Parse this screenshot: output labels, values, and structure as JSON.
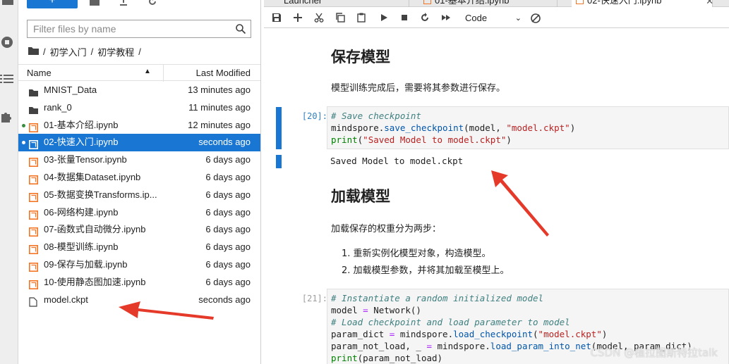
{
  "activity_bar": {
    "icons": [
      "folder-icon",
      "running-icon",
      "list-icon",
      "extension-icon"
    ]
  },
  "file_browser": {
    "new_button_label": "+",
    "filter_placeholder": "Filter files by name",
    "breadcrumbs": [
      "/",
      "初学入门",
      "/",
      "初学教程",
      "/"
    ],
    "header": {
      "name": "Name",
      "last_modified": "Last Modified"
    },
    "files": [
      {
        "name": "MNIST_Data",
        "modified": "13 minutes ago",
        "type": "folder"
      },
      {
        "name": "rank_0",
        "modified": "11 minutes ago",
        "type": "folder"
      },
      {
        "name": "01-基本介绍.ipynb",
        "modified": "12 minutes ago",
        "type": "notebook",
        "running": true
      },
      {
        "name": "02-快速入门.ipynb",
        "modified": "seconds ago",
        "type": "notebook",
        "running": true,
        "selected": true
      },
      {
        "name": "03-张量Tensor.ipynb",
        "modified": "6 days ago",
        "type": "notebook"
      },
      {
        "name": "04-数据集Dataset.ipynb",
        "modified": "6 days ago",
        "type": "notebook"
      },
      {
        "name": "05-数据变换Transforms.ip...",
        "modified": "6 days ago",
        "type": "notebook"
      },
      {
        "name": "06-网络构建.ipynb",
        "modified": "6 days ago",
        "type": "notebook"
      },
      {
        "name": "07-函数式自动微分.ipynb",
        "modified": "6 days ago",
        "type": "notebook"
      },
      {
        "name": "08-模型训练.ipynb",
        "modified": "6 days ago",
        "type": "notebook"
      },
      {
        "name": "09-保存与加载.ipynb",
        "modified": "6 days ago",
        "type": "notebook"
      },
      {
        "name": "10-使用静态图加速.ipynb",
        "modified": "6 days ago",
        "type": "notebook"
      },
      {
        "name": "model.ckpt",
        "modified": "seconds ago",
        "type": "file"
      }
    ]
  },
  "tabs": [
    {
      "label": "Launcher"
    },
    {
      "label": "01-基本介绍.ipynb"
    },
    {
      "label": "02-快速入门.ipynb",
      "active": true
    }
  ],
  "toolbar": {
    "cell_type": "Code"
  },
  "notebook": {
    "h_save": "保存模型",
    "p_save": "模型训练完成后，需要将其参数进行保存。",
    "cell20_prompt": "[20]:",
    "cell20_output": "Saved Model to model.ckpt",
    "h_load": "加载模型",
    "p_load": "加载保存的权重分为两步：",
    "list_items": [
      "重新实例化模型对象，构造模型。",
      "加载模型参数，并将其加载至模型上。"
    ],
    "cell21_prompt": "[21]:"
  },
  "watermark": "CSDN @植拉图斯特拉talk"
}
